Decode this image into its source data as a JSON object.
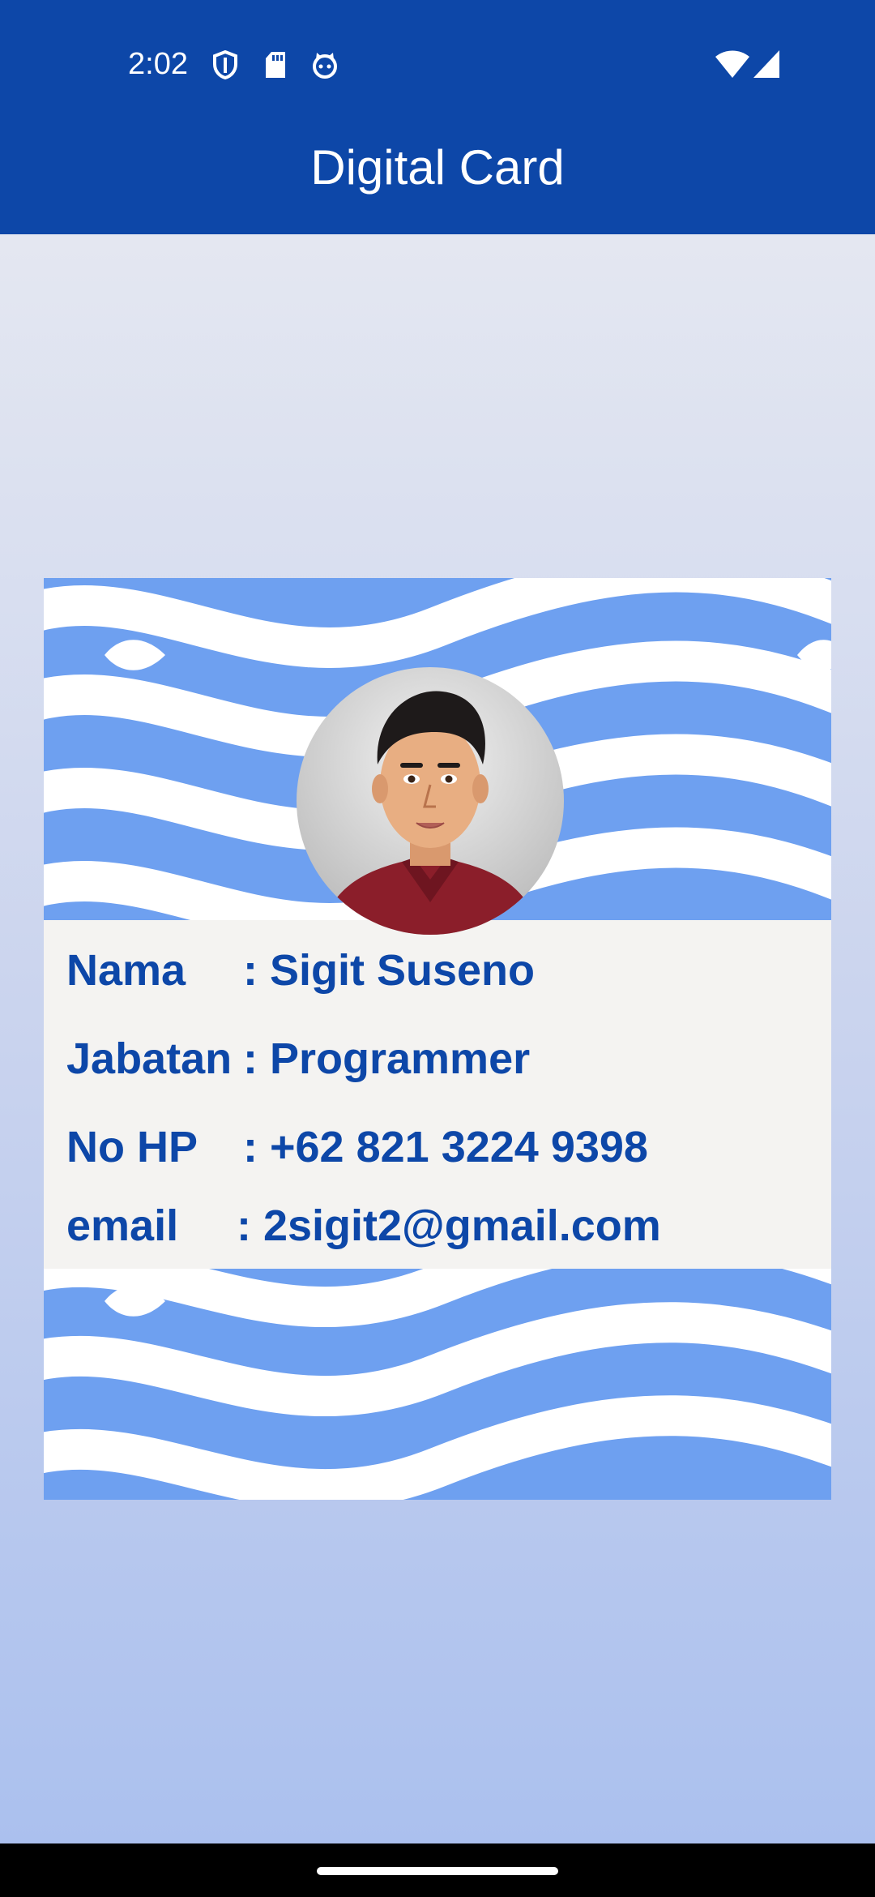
{
  "status_bar": {
    "time": "2:02",
    "icons_left": [
      "shield-icon",
      "sd-card-icon",
      "cat-face-icon"
    ],
    "icons_right": [
      "wifi-icon",
      "cellular-signal-icon"
    ],
    "background": "#0D47A8"
  },
  "app_bar": {
    "title": "Digital Card",
    "background": "#0D47A8"
  },
  "card": {
    "avatar_icon": "profile-avatar",
    "pattern_colors": [
      "#6EA0F0",
      "#FFFFFF"
    ],
    "fields": [
      {
        "label": "Nama",
        "value": ": Sigit Suseno"
      },
      {
        "label": "Jabatan",
        "value": ": Programmer"
      },
      {
        "label": "No HP",
        "value": ": +62 821 3224 9398"
      },
      {
        "label": "email",
        "value": ": 2sigit2@gmail.com"
      }
    ],
    "text_color": "#0D47A8"
  }
}
